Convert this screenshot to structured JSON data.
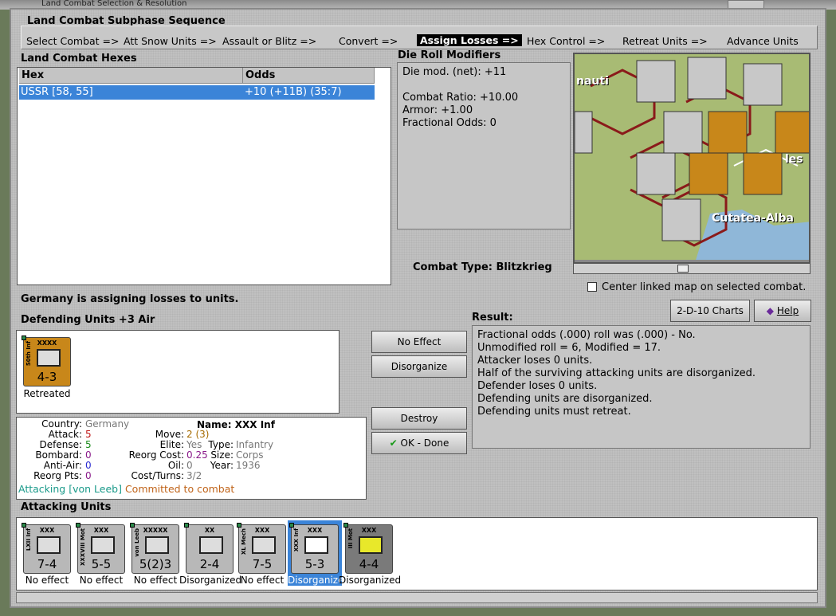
{
  "window": {
    "title": "Land Combat Selection & Resolution"
  },
  "sequence": {
    "title": "Land Combat Subphase Sequence",
    "steps": [
      "Select Combat =>",
      "Att Snow Units =>",
      "Assault or Blitz =>",
      "Convert =>",
      "Assign Losses =>",
      "Hex Control =>",
      "Retreat Units =>",
      "Advance Units"
    ],
    "active_step": "Assign Losses =>"
  },
  "hexes": {
    "title": "Land Combat Hexes",
    "columns": [
      "Hex",
      "Odds"
    ],
    "rows": [
      {
        "hex": "USSR [58, 55]",
        "odds": "+10 (+11B) (35:7)"
      }
    ]
  },
  "modifiers": {
    "title": "Die Roll Modifiers",
    "lines": [
      "Die mod. (net): +11",
      "",
      "Combat Ratio: +10.00",
      "Armor: +1.00",
      "Fractional Odds: 0"
    ]
  },
  "combat_type": {
    "label": "Combat Type:",
    "value": "Blitzkrieg"
  },
  "map": {
    "labels": [
      "nauti",
      "les",
      "Cutatea-Alba"
    ],
    "center_checkbox": "Center linked map on selected combat."
  },
  "status": "Germany is assigning losses to units.",
  "defending": {
    "title": "Defending Units +3 Air",
    "units": [
      {
        "size": "XXXX",
        "name": "50th Inf",
        "strength": "4-3",
        "caption": "Retreated",
        "color": "#c8871a"
      }
    ]
  },
  "buttons": {
    "no_effect": "No Effect",
    "disorganize": "Disorganize",
    "destroy": "Destroy",
    "ok": "OK - Done",
    "charts": "2-D-10 Charts",
    "help": "Help"
  },
  "result": {
    "title": "Result:",
    "lines": [
      "Fractional odds (.000) roll was (.000)  - No.",
      "Unmodified roll = 6, Modified = 17.",
      "Attacker loses 0 units.",
      "Half of the surviving attacking units are disorganized.",
      "Defender loses 0 units.",
      "Defending units are disorganized.",
      "Defending units must retreat."
    ]
  },
  "details": {
    "country_k": "Country:",
    "country_v": "Germany",
    "attack_k": "Attack:",
    "attack_v": "5",
    "defense_k": "Defense:",
    "defense_v": "5",
    "bombard_k": "Bombard:",
    "bombard_v": "0",
    "antiair_k": "Anti-Air:",
    "antiair_v": "0",
    "reorg_k": "Reorg Pts:",
    "reorg_v": "0",
    "name_k": "Name:",
    "name_v": "XXX Inf",
    "move_k": "Move:",
    "move_v": "2 (3)",
    "type_k": "Type:",
    "type_v": "Infantry",
    "elite_k": "Elite:",
    "elite_v": "Yes",
    "size_k": "Size:",
    "size_v": "Corps",
    "reorgcost_k": "Reorg Cost:",
    "reorgcost_v": "0.25",
    "year_k": "Year:",
    "year_v": "1936",
    "oil_k": "Oil:",
    "oil_v": "0",
    "cost_k": "Cost/Turns:",
    "cost_v": "3/2",
    "attacking_note": "Attacking [von Leeb]",
    "committed_note": "Committed to combat"
  },
  "attacking": {
    "title": "Attacking Units",
    "units": [
      {
        "size": "XXX",
        "name": "LXII Inf",
        "strength": "7-4",
        "caption": "No effect"
      },
      {
        "size": "XXX",
        "name": "XXXVIII Mot",
        "strength": "5-5",
        "caption": "No effect"
      },
      {
        "size": "XXXXX",
        "name": "von Leeb",
        "strength": "5(2)3",
        "caption": "No effect"
      },
      {
        "size": "XX",
        "name": "",
        "strength": "2-4",
        "caption": "Disorganized"
      },
      {
        "size": "XXX",
        "name": "XL Mech",
        "strength": "7-5",
        "caption": "No effect"
      },
      {
        "size": "XXX",
        "name": "XXX Inf",
        "strength": "5-3",
        "caption": "Disorganized"
      },
      {
        "size": "XXX",
        "name": "III Mot",
        "strength": "4-4",
        "caption": "Disorganized"
      }
    ]
  }
}
